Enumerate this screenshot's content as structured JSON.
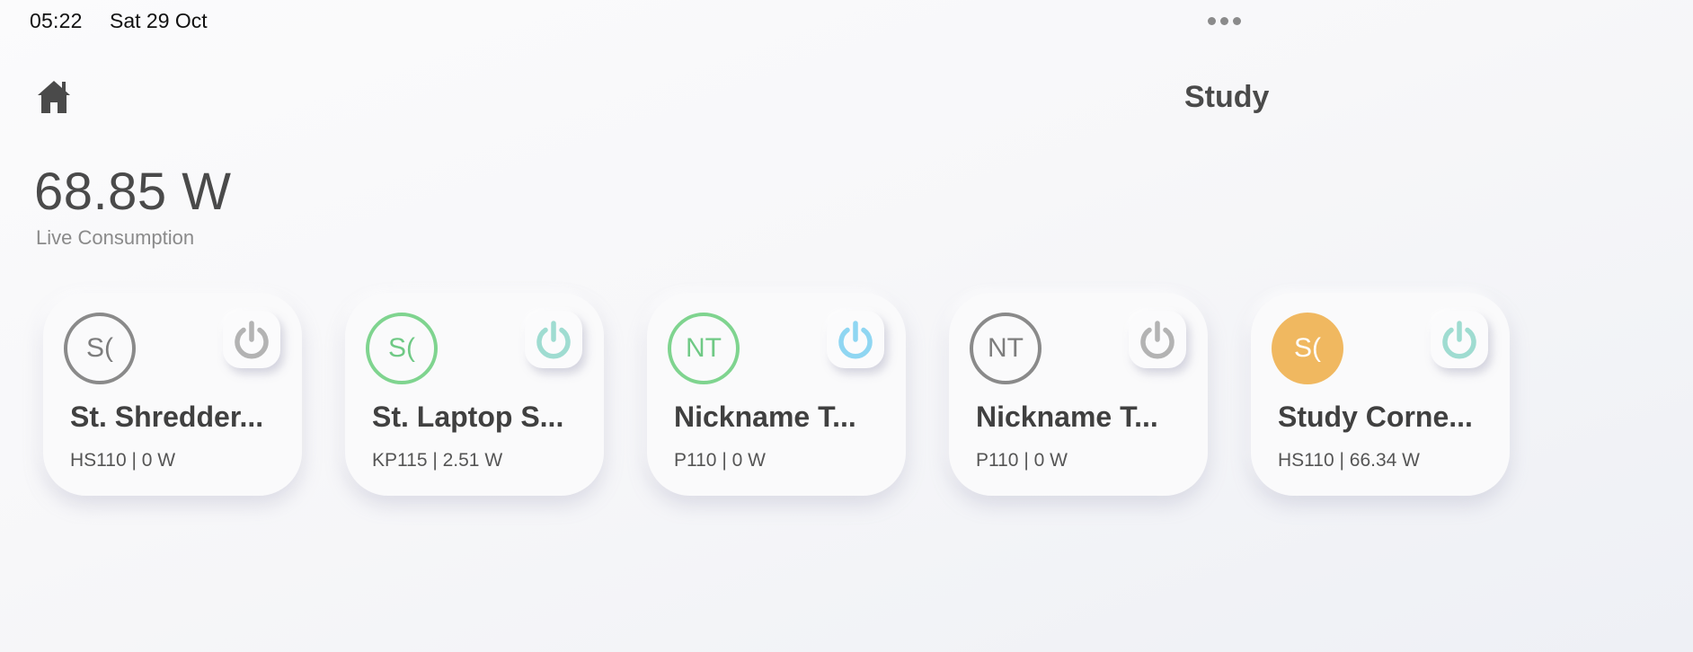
{
  "status_bar": {
    "time": "05:22",
    "date": "Sat 29 Oct"
  },
  "header": {
    "home_icon": "home-icon",
    "title": "Study"
  },
  "consumption": {
    "value": "68.85 W",
    "label": "Live Consumption"
  },
  "colors": {
    "power_off": "#b3b3b3",
    "power_teal": "#9fdcd1",
    "power_blue": "#8fd6f2",
    "avatar_green": "#7fd48f",
    "avatar_orange": "#f0b860",
    "avatar_gray": "#8a8a8a"
  },
  "devices": [
    {
      "initials": "S(",
      "name": "St. Shredder...",
      "meta": "HS110 | 0 W",
      "avatar_style": "gray-outline",
      "power_color": "#b3b3b3"
    },
    {
      "initials": "S(",
      "name": "St. Laptop S...",
      "meta": "KP115 | 2.51 W",
      "avatar_style": "green-outline",
      "power_color": "#9fdcd1"
    },
    {
      "initials": "NT",
      "name": "Nickname T...",
      "meta": "P110 | 0 W",
      "avatar_style": "green-outline",
      "power_color": "#8fd6f2"
    },
    {
      "initials": "NT",
      "name": "Nickname T...",
      "meta": "P110 | 0 W",
      "avatar_style": "gray-outline",
      "power_color": "#b3b3b3"
    },
    {
      "initials": "S(",
      "name": "Study Corne...",
      "meta": "HS110 | 66.34 W",
      "avatar_style": "orange-filled",
      "power_color": "#9fdcd1"
    }
  ]
}
